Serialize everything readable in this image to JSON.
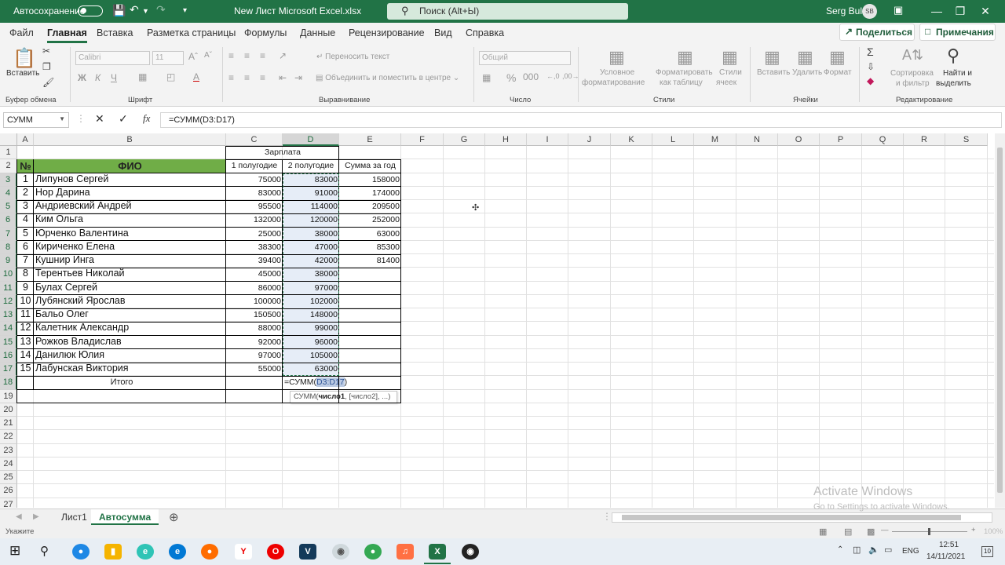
{
  "titlebar": {
    "autosave_label": "Автосохранение",
    "file_title": "New Лист Microsoft Excel.xlsx",
    "search_placeholder": "Поиск (Alt+Ы)",
    "user_name": "Serg Bul",
    "user_initials": "SB"
  },
  "menu": {
    "tabs": [
      "Файл",
      "Главная",
      "Вставка",
      "Разметка страницы",
      "Формулы",
      "Данные",
      "Рецензирование",
      "Вид",
      "Справка"
    ],
    "active": "Главная",
    "share_label": "Поделиться",
    "comments_label": "Примечания"
  },
  "ribbon": {
    "groups": [
      "Буфер обмена",
      "Шрифт",
      "Выравнивание",
      "Число",
      "Стили",
      "Ячейки",
      "Редактирование"
    ],
    "paste_label": "Вставить",
    "font_name": "Calibri",
    "font_size": "11",
    "wrap_text": "Переносить текст",
    "merge_center": "Объединить и поместить в центре",
    "number_format": "Общий",
    "cond_format": [
      "Условное",
      "форматирование"
    ],
    "format_table": [
      "Форматировать",
      "как таблицу"
    ],
    "cell_styles": [
      "Стили",
      "ячеек"
    ],
    "insert": "Вставить",
    "delete": "Удалить",
    "format": "Формат",
    "sort_filter": [
      "Сортировка",
      "и фильтр"
    ],
    "find_select": [
      "Найти и",
      "выделить"
    ]
  },
  "formula_bar": {
    "name_box": "СУММ",
    "formula": "=СУММ(D3:D17)"
  },
  "columns": [
    "A",
    "B",
    "C",
    "D",
    "E",
    "F",
    "G",
    "H",
    "I",
    "J",
    "K",
    "L",
    "M",
    "N",
    "O",
    "P",
    "Q",
    "R",
    "S"
  ],
  "rows": [
    "1",
    "2",
    "3",
    "4",
    "5",
    "6",
    "7",
    "8",
    "9",
    "10",
    "11",
    "12",
    "13",
    "14",
    "15",
    "16",
    "17",
    "18",
    "19",
    "20",
    "21",
    "22",
    "23",
    "24",
    "25",
    "26",
    "27"
  ],
  "table": {
    "header_salary": "Зарплата",
    "header_num": "№",
    "header_fio": "ФИО",
    "header_h1": "1 полугодие",
    "header_h2": "2 полугодие",
    "header_year": "Сумма за год",
    "data": [
      {
        "n": "1",
        "name": "Липунов Сергей",
        "h1": "75000",
        "h2": "83000",
        "year": "158000"
      },
      {
        "n": "2",
        "name": "Нор Дарина",
        "h1": "83000",
        "h2": "91000",
        "year": "174000"
      },
      {
        "n": "3",
        "name": "Андриевский Андрей",
        "h1": "95500",
        "h2": "114000",
        "year": "209500"
      },
      {
        "n": "4",
        "name": "Ким Ольга",
        "h1": "132000",
        "h2": "120000",
        "year": "252000"
      },
      {
        "n": "5",
        "name": "Юрченко Валентина",
        "h1": "25000",
        "h2": "38000",
        "year": "63000"
      },
      {
        "n": "6",
        "name": "Кириченко Елена",
        "h1": "38300",
        "h2": "47000",
        "year": "85300"
      },
      {
        "n": "7",
        "name": "Кушнир Инга",
        "h1": "39400",
        "h2": "42000",
        "year": "81400"
      },
      {
        "n": "8",
        "name": "Терентьев Николай",
        "h1": "45000",
        "h2": "38000",
        "year": ""
      },
      {
        "n": "9",
        "name": "Булах Сергей",
        "h1": "86000",
        "h2": "97000",
        "year": ""
      },
      {
        "n": "10",
        "name": "Лубянский Ярослав",
        "h1": "100000",
        "h2": "102000",
        "year": ""
      },
      {
        "n": "11",
        "name": "Бальо Олег",
        "h1": "150500",
        "h2": "148000",
        "year": ""
      },
      {
        "n": "12",
        "name": "Калетник Александр",
        "h1": "88000",
        "h2": "99000",
        "year": ""
      },
      {
        "n": "13",
        "name": "Рожков Владислав",
        "h1": "92000",
        "h2": "96000",
        "year": ""
      },
      {
        "n": "14",
        "name": "Данилюк Юлия",
        "h1": "97000",
        "h2": "105000",
        "year": ""
      },
      {
        "n": "15",
        "name": "Лабунская Виктория",
        "h1": "55000",
        "h2": "63000",
        "year": ""
      }
    ],
    "total_label": "Итого",
    "editing_prefix": "=СУММ(",
    "editing_range": "D3:D17",
    "editing_suffix": ")",
    "tooltip_fn": "СУММ(",
    "tooltip_arg1": "число1",
    "tooltip_rest": ", [число2], ...)"
  },
  "sheets": [
    "Лист1",
    "Автосумма"
  ],
  "active_sheet": "Автосумма",
  "status": {
    "mode": "Укажите",
    "zoom": "100%"
  },
  "watermark": {
    "line1": "Activate Windows",
    "line2": "Go to Settings to activate Windows."
  },
  "taskbar": {
    "lang": "ENG",
    "time": "12:51",
    "date": "14/11/2021",
    "notif": "10"
  },
  "colors": {
    "excel_green": "#217346",
    "table_header_fill": "#70ad47",
    "selection_fill": "#e6edf7"
  }
}
